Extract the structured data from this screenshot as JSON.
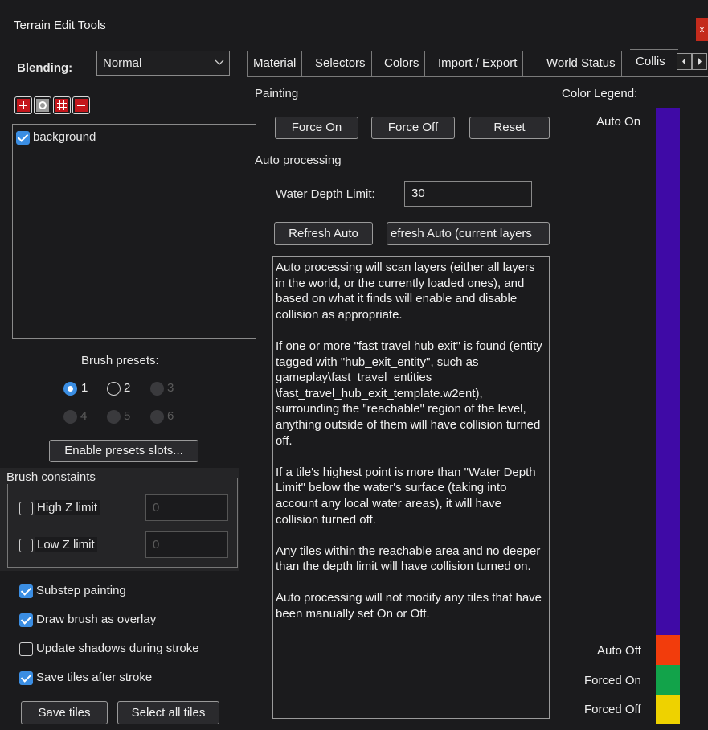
{
  "window": {
    "title": "Terrain Edit Tools",
    "close_glyph": "x"
  },
  "blending": {
    "label": "Blending:",
    "value": "Normal"
  },
  "toolbar": {
    "icons": [
      "add-icon",
      "circle-icon",
      "grid-icon",
      "remove-icon"
    ]
  },
  "layers": [
    {
      "name": "background",
      "checked": true
    }
  ],
  "brush_presets": {
    "label": "Brush presets:",
    "options": [
      {
        "label": "1",
        "selected": true,
        "enabled": true
      },
      {
        "label": "2",
        "selected": false,
        "enabled": true
      },
      {
        "label": "3",
        "selected": false,
        "enabled": false
      },
      {
        "label": "4",
        "selected": false,
        "enabled": false
      },
      {
        "label": "5",
        "selected": false,
        "enabled": false
      },
      {
        "label": "6",
        "selected": false,
        "enabled": false
      }
    ],
    "enable_slots_label": "Enable presets slots..."
  },
  "constraints": {
    "group_label": "Brush constaints",
    "high_z": {
      "label": "High Z limit",
      "value": "0",
      "checked": false
    },
    "low_z": {
      "label": "Low Z limit",
      "value": "0",
      "checked": false
    }
  },
  "options": [
    {
      "label": "Substep painting",
      "checked": true
    },
    {
      "label": "Draw brush as overlay",
      "checked": true
    },
    {
      "label": "Update shadows during stroke",
      "checked": false
    },
    {
      "label": "Save tiles after stroke",
      "checked": true
    }
  ],
  "bottom_buttons": {
    "save": "Save tiles",
    "select_all": "Select all tiles"
  },
  "tabs": [
    "Material",
    "Selectors",
    "Colors",
    "Import / Export",
    "World Status",
    "Collis"
  ],
  "painting": {
    "label": "Painting",
    "force_on": "Force On",
    "force_off": "Force Off",
    "reset": "Reset"
  },
  "auto": {
    "label": "Auto processing",
    "water_depth_label": "Water Depth Limit:",
    "water_depth_value": "30",
    "refresh_auto": "Refresh Auto",
    "refresh_auto_current": "efresh Auto (current layers"
  },
  "info_paragraphs": [
    "Auto processing will scan layers (either all layers in the world, or the currently loaded ones), and based on what it finds will enable and disable collision as appropriate.",
    "If one or more \"fast travel hub exit\" is found (entity tagged with \"hub_exit_entity\", such as gameplay\\fast_travel_entities \\fast_travel_hub_exit_template.w2ent), surrounding the \"reachable\" region of the level, anything outside of them will have collision turned off.",
    "If a tile's highest point is more than \"Water Depth Limit\" below the water's surface (taking into account any local water areas), it will have collision turned off.",
    "Any tiles within the reachable area and no deeper than the depth limit will have collision turned on.",
    "Auto processing will not modify any tiles that have been manually set On or Off."
  ],
  "legend": {
    "title": "Color Legend:",
    "items": [
      {
        "label": "Auto On",
        "color": "#3f0aa6"
      },
      {
        "label": "Auto Off",
        "color": "#f23c0c"
      },
      {
        "label": "Forced On",
        "color": "#12a34a"
      },
      {
        "label": "Forced Off",
        "color": "#eed200"
      }
    ]
  }
}
